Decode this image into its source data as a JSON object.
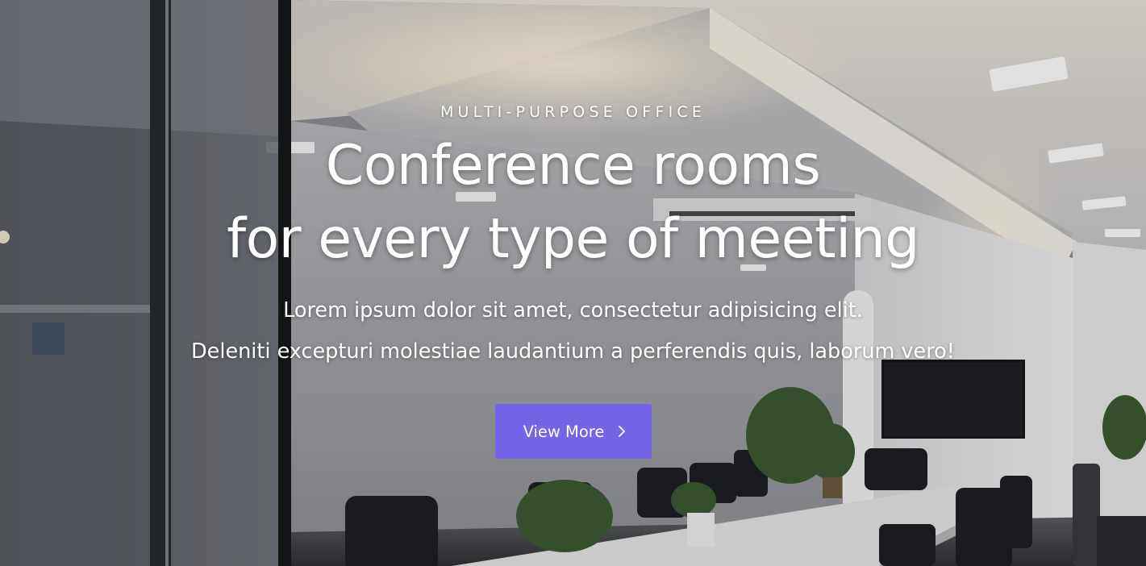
{
  "hero": {
    "eyebrow": "MULTI-PURPOSE OFFICE",
    "title_line1": "Conference rooms",
    "title_line2": "for every type of meeting",
    "subtitle_line1": "Lorem ipsum dolor sit amet, consectetur adipisicing elit.",
    "subtitle_line2": "Deleniti excepturi molestiae laudantium a perferendis quis, laborum vero!",
    "cta_label": "View More",
    "cta_icon": "chevron-right-icon"
  },
  "colors": {
    "accent": "#7563e8",
    "text": "#ffffff"
  }
}
